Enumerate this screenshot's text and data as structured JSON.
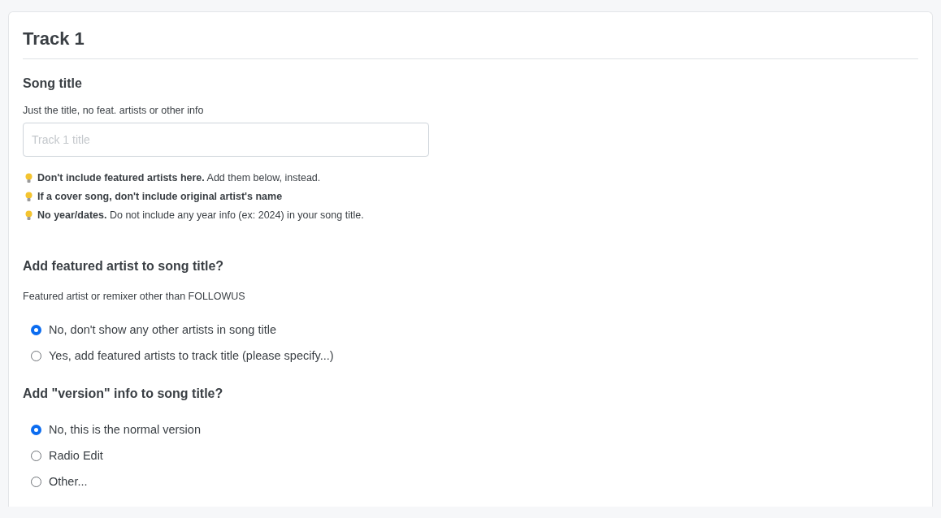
{
  "card": {
    "title": "Track 1"
  },
  "song_title": {
    "label": "Song title",
    "help": "Just the title, no feat. artists or other info",
    "input": {
      "placeholder": "Track 1 title"
    },
    "tips": [
      {
        "text": "**Don't include featured artists here.** Add them below, instead.",
        "bold": false
      },
      {
        "text": "If a cover song, don't include original artist's name",
        "bold": true
      },
      {
        "text": "**No year/dates.** Do not include any year info (ex: 2024) in your song title.",
        "bold": false
      }
    ]
  },
  "featured": {
    "label": "Add featured artist to song title?",
    "help": "Featured artist or remixer other than FOLLOWUS",
    "options": [
      {
        "label": "No, don't show any other artists in song title",
        "selected": true
      },
      {
        "label": "Yes, add featured artists to track title (please specify...)",
        "selected": false
      }
    ]
  },
  "version": {
    "label": "Add \"version\" info to song title?",
    "options": [
      {
        "label": "No, this is the normal version",
        "selected": true
      },
      {
        "label": "Radio Edit",
        "selected": false
      },
      {
        "label": "Other...",
        "selected": false
      }
    ]
  }
}
